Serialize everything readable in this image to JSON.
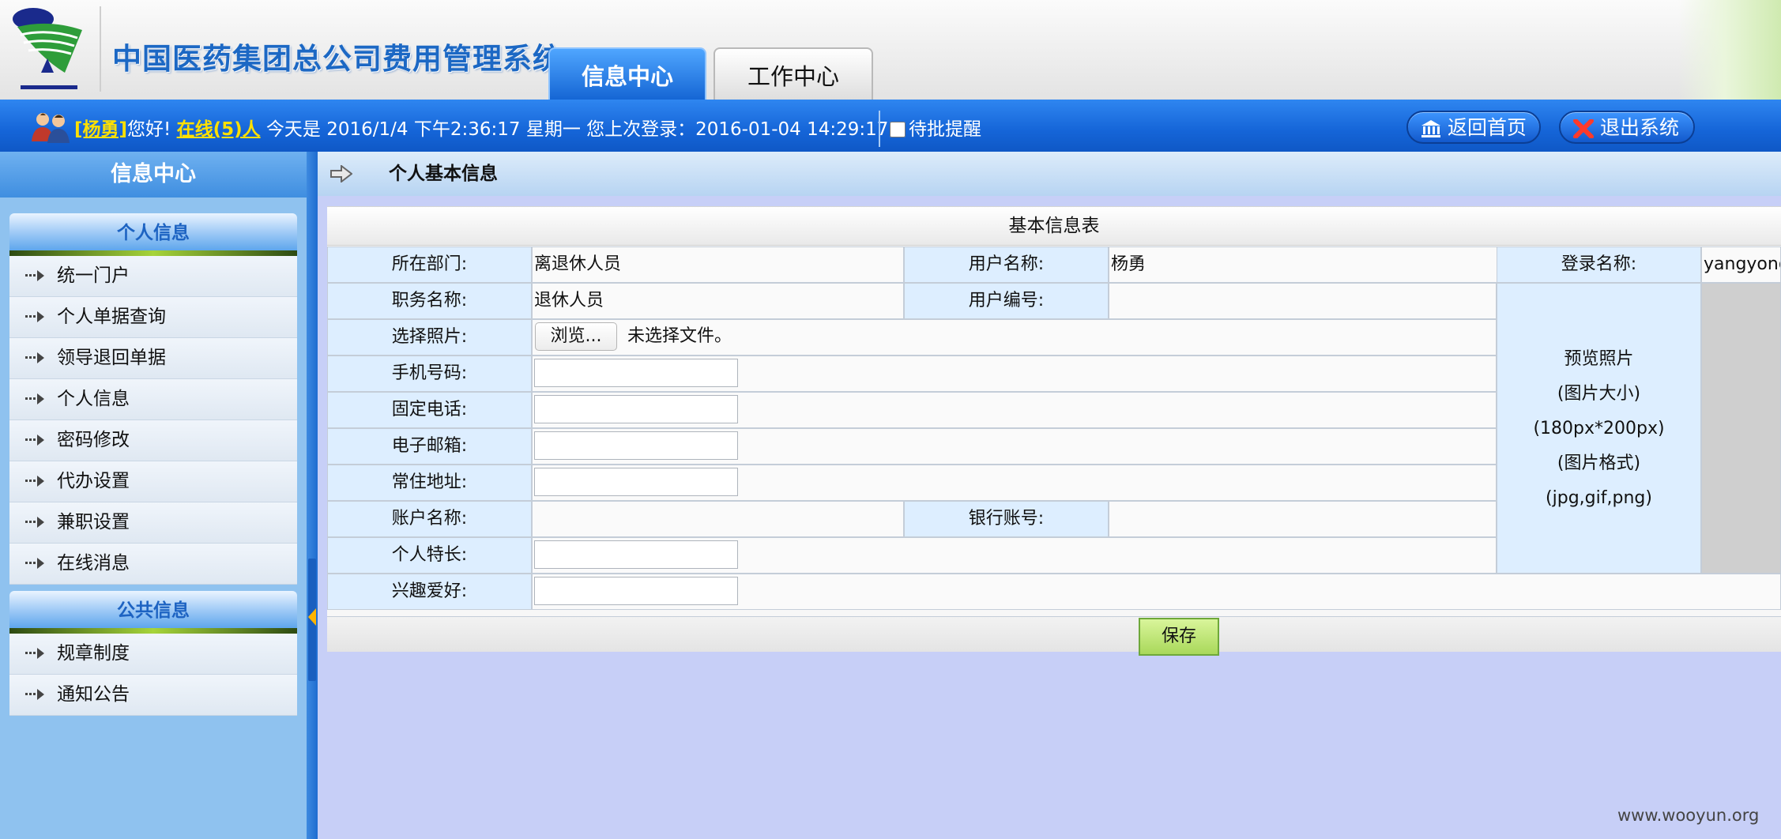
{
  "header": {
    "system_title": "中国医药集团总公司费用管理系统",
    "tabs": [
      {
        "label": "信息中心",
        "active": true
      },
      {
        "label": "工作中心",
        "active": false
      }
    ]
  },
  "infobar": {
    "user_name": "[杨勇]",
    "greeting": "您好!",
    "online": "在线(5)人",
    "today": "今天是 2016/1/4 下午2:36:17 星期一",
    "last_login": "您上次登录：2016-01-04 14:29:17",
    "remind_label": "待批提醒",
    "remind_checked": false,
    "home_button": "返回首页",
    "exit_button": "退出系统"
  },
  "sidebar": {
    "title": "信息中心",
    "sections": [
      {
        "title": "个人信息",
        "items": [
          "统一门户",
          "个人单据查询",
          "领导退回单据",
          "个人信息",
          "密码修改",
          "代办设置",
          "兼职设置",
          "在线消息"
        ]
      },
      {
        "title": "公共信息",
        "items": [
          "规章制度",
          "通知公告"
        ]
      }
    ]
  },
  "breadcrumb": "个人基本信息",
  "form": {
    "title": "基本信息表",
    "department_label": "所在部门:",
    "department_value": "离退休人员",
    "username_label": "用户名称:",
    "username_value": "杨勇",
    "login_label": "登录名称:",
    "login_value": "yangyong",
    "position_label": "职务名称:",
    "position_value": "退休人员",
    "usercode_label": "用户编号:",
    "usercode_value": "",
    "photo_label": "选择照片:",
    "browse_button": "浏览...",
    "no_file_text": "未选择文件。",
    "mobile_label": "手机号码:",
    "mobile_value": "",
    "phone_label": "固定电话:",
    "phone_value": "",
    "email_label": "电子邮箱:",
    "email_value": "",
    "address_label": "常住地址:",
    "address_value": "",
    "account_label": "账户名称:",
    "account_value": "",
    "bank_label": "银行账号:",
    "bank_value": "",
    "specialty_label": "个人特长:",
    "specialty_value": "",
    "hobby_label": "兴趣爱好:",
    "hobby_value": "",
    "preview": {
      "line1": "预览照片",
      "line2": "(图片大小)",
      "line3": "(180px*200px)",
      "line4": "(图片格式)",
      "line5": "(jpg,gif,png)"
    },
    "save_button": "保存"
  },
  "watermark": "www.wooyun.org",
  "colors": {
    "brand_blue": "#1565d8",
    "highlight_yellow": "#ffe000",
    "label_cell_bg": "#ddeeff",
    "save_green": "#a9d85a"
  }
}
